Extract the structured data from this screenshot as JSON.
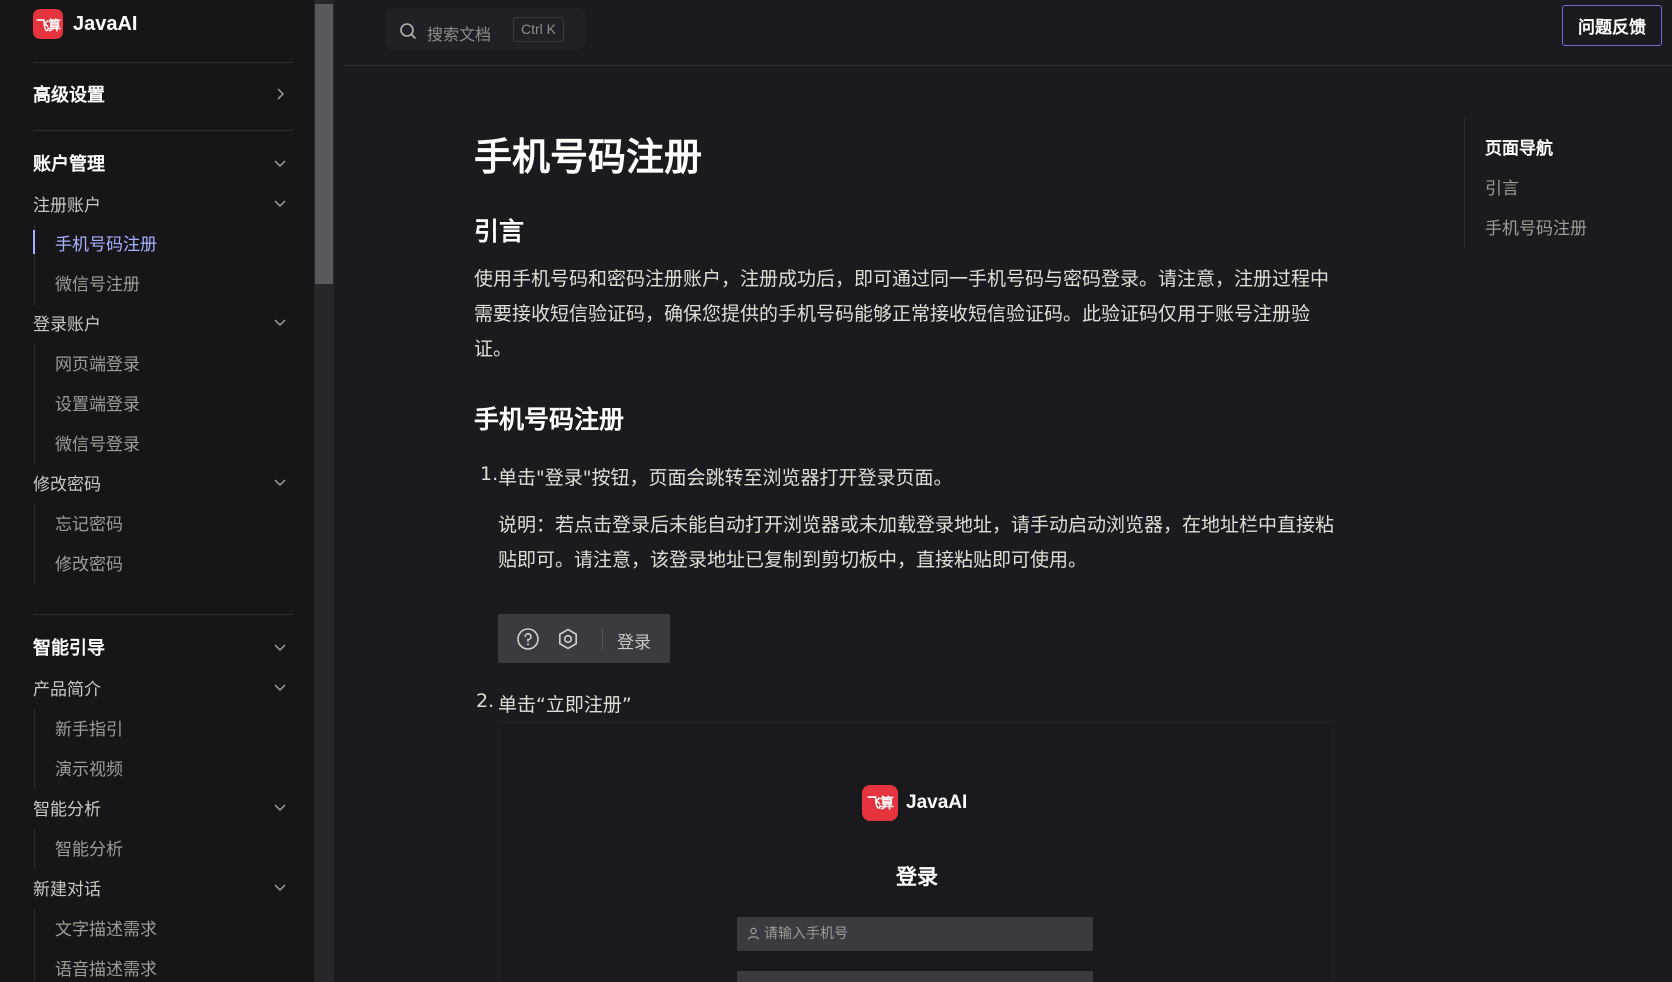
{
  "brand": {
    "logo_text": "飞算",
    "name": "JavaAI"
  },
  "search": {
    "placeholder": "搜索文档",
    "shortcut": "Ctrl K"
  },
  "header": {
    "feedback_label": "问题反馈"
  },
  "sidebar": {
    "sections": [
      {
        "label": "高级设置",
        "chevron": "chevron-right-icon"
      },
      {
        "label": "账户管理",
        "chevron": "chevron-down-icon"
      },
      {
        "label": "智能引导",
        "chevron": "chevron-down-icon"
      }
    ],
    "subgroups": [
      {
        "label": "注册账户"
      },
      {
        "label": "登录账户"
      },
      {
        "label": "修改密码"
      },
      {
        "label": "产品简介"
      },
      {
        "label": "智能分析"
      },
      {
        "label": "新建对话"
      }
    ],
    "items": [
      {
        "label": "手机号码注册",
        "active": true
      },
      {
        "label": "微信号注册"
      },
      {
        "label": "网页端登录"
      },
      {
        "label": "设置端登录"
      },
      {
        "label": "微信号登录"
      },
      {
        "label": "忘记密码"
      },
      {
        "label": "修改密码"
      },
      {
        "label": "新手指引"
      },
      {
        "label": "演示视频"
      },
      {
        "label": "智能分析"
      },
      {
        "label": "文字描述需求"
      },
      {
        "label": "语音描述需求"
      }
    ]
  },
  "main": {
    "title": "手机号码注册",
    "intro_heading": "引言",
    "intro_text": "使用手机号码和密码注册账户，注册成功后，即可通过同一手机号码与密码登录。请注意，注册过程中需要接收短信验证码，确保您提供的手机号码能够正常接收短信验证码。此验证码仅用于账号注册验证。",
    "section_heading": "手机号码注册",
    "steps": [
      {
        "num": "1.",
        "text": "单击\"登录\"按钮，页面会跳转至浏览器打开登录页面。"
      },
      {
        "num": "2.",
        "text": "单击“立即注册”"
      }
    ],
    "note": "说明：若点击登录后未能自动打开浏览器或未加载登录地址，请手动启动浏览器，在地址栏中直接粘贴即可。请注意，该登录地址已复制到剪切板中，直接粘贴即可使用。",
    "demo_toolbar": {
      "login_label": "登录",
      "icons": [
        "help-icon",
        "settings-icon"
      ]
    },
    "screenshot": {
      "logo_text": "飞算",
      "brand_name": "JavaAI",
      "title": "登录",
      "phone_placeholder": "请输入手机号"
    }
  },
  "aside": {
    "title": "页面导航",
    "links": [
      "引言",
      "手机号码注册"
    ]
  },
  "colors": {
    "background": "#1b1b1f",
    "sidebar": "#161618",
    "accent": "#a8b1ff",
    "brand_red": "#e5343d",
    "feedback_border": "#6b6fd6"
  }
}
